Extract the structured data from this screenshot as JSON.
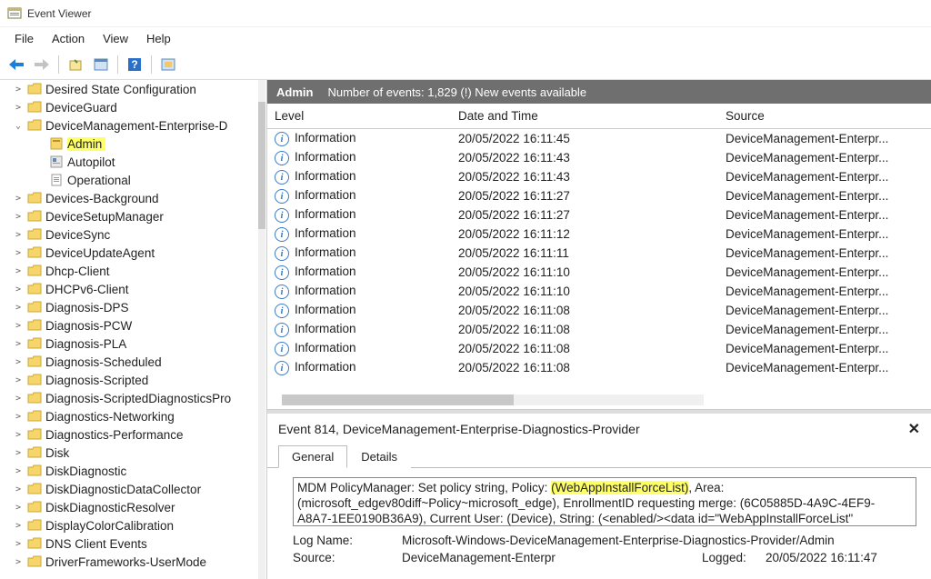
{
  "window": {
    "title": "Event Viewer"
  },
  "menu": {
    "file": "File",
    "action": "Action",
    "view": "View",
    "help": "Help"
  },
  "tree": {
    "items": [
      {
        "label": "Desired State Configuration",
        "lvl": 1,
        "exp": ">",
        "icon": "folder"
      },
      {
        "label": "DeviceGuard",
        "lvl": 1,
        "exp": ">",
        "icon": "folder"
      },
      {
        "label": "DeviceManagement-Enterprise-D",
        "lvl": 1,
        "exp": "v",
        "icon": "folder"
      },
      {
        "label": "Admin",
        "lvl": 2,
        "exp": "",
        "icon": "log",
        "hl": true
      },
      {
        "label": "Autopilot",
        "lvl": 2,
        "exp": "",
        "icon": "log"
      },
      {
        "label": "Operational",
        "lvl": 2,
        "exp": "",
        "icon": "log"
      },
      {
        "label": "Devices-Background",
        "lvl": 1,
        "exp": ">",
        "icon": "folder"
      },
      {
        "label": "DeviceSetupManager",
        "lvl": 1,
        "exp": ">",
        "icon": "folder"
      },
      {
        "label": "DeviceSync",
        "lvl": 1,
        "exp": ">",
        "icon": "folder"
      },
      {
        "label": "DeviceUpdateAgent",
        "lvl": 1,
        "exp": ">",
        "icon": "folder"
      },
      {
        "label": "Dhcp-Client",
        "lvl": 1,
        "exp": ">",
        "icon": "folder"
      },
      {
        "label": "DHCPv6-Client",
        "lvl": 1,
        "exp": ">",
        "icon": "folder"
      },
      {
        "label": "Diagnosis-DPS",
        "lvl": 1,
        "exp": ">",
        "icon": "folder"
      },
      {
        "label": "Diagnosis-PCW",
        "lvl": 1,
        "exp": ">",
        "icon": "folder"
      },
      {
        "label": "Diagnosis-PLA",
        "lvl": 1,
        "exp": ">",
        "icon": "folder"
      },
      {
        "label": "Diagnosis-Scheduled",
        "lvl": 1,
        "exp": ">",
        "icon": "folder"
      },
      {
        "label": "Diagnosis-Scripted",
        "lvl": 1,
        "exp": ">",
        "icon": "folder"
      },
      {
        "label": "Diagnosis-ScriptedDiagnosticsPro",
        "lvl": 1,
        "exp": ">",
        "icon": "folder"
      },
      {
        "label": "Diagnostics-Networking",
        "lvl": 1,
        "exp": ">",
        "icon": "folder"
      },
      {
        "label": "Diagnostics-Performance",
        "lvl": 1,
        "exp": ">",
        "icon": "folder"
      },
      {
        "label": "Disk",
        "lvl": 1,
        "exp": ">",
        "icon": "folder"
      },
      {
        "label": "DiskDiagnostic",
        "lvl": 1,
        "exp": ">",
        "icon": "folder"
      },
      {
        "label": "DiskDiagnosticDataCollector",
        "lvl": 1,
        "exp": ">",
        "icon": "folder"
      },
      {
        "label": "DiskDiagnosticResolver",
        "lvl": 1,
        "exp": ">",
        "icon": "folder"
      },
      {
        "label": "DisplayColorCalibration",
        "lvl": 1,
        "exp": ">",
        "icon": "folder"
      },
      {
        "label": "DNS Client Events",
        "lvl": 1,
        "exp": ">",
        "icon": "folder"
      },
      {
        "label": "DriverFrameworks-UserMode",
        "lvl": 1,
        "exp": ">",
        "icon": "folder"
      }
    ]
  },
  "panel": {
    "name": "Admin",
    "status": "Number of events: 1,829 (!) New events available"
  },
  "columns": {
    "level": "Level",
    "date": "Date and Time",
    "source": "Source"
  },
  "events": [
    {
      "level": "Information",
      "date": "20/05/2022 16:11:45",
      "source": "DeviceManagement-Enterpr..."
    },
    {
      "level": "Information",
      "date": "20/05/2022 16:11:43",
      "source": "DeviceManagement-Enterpr..."
    },
    {
      "level": "Information",
      "date": "20/05/2022 16:11:43",
      "source": "DeviceManagement-Enterpr..."
    },
    {
      "level": "Information",
      "date": "20/05/2022 16:11:27",
      "source": "DeviceManagement-Enterpr..."
    },
    {
      "level": "Information",
      "date": "20/05/2022 16:11:27",
      "source": "DeviceManagement-Enterpr..."
    },
    {
      "level": "Information",
      "date": "20/05/2022 16:11:12",
      "source": "DeviceManagement-Enterpr..."
    },
    {
      "level": "Information",
      "date": "20/05/2022 16:11:11",
      "source": "DeviceManagement-Enterpr..."
    },
    {
      "level": "Information",
      "date": "20/05/2022 16:11:10",
      "source": "DeviceManagement-Enterpr..."
    },
    {
      "level": "Information",
      "date": "20/05/2022 16:11:10",
      "source": "DeviceManagement-Enterpr..."
    },
    {
      "level": "Information",
      "date": "20/05/2022 16:11:08",
      "source": "DeviceManagement-Enterpr..."
    },
    {
      "level": "Information",
      "date": "20/05/2022 16:11:08",
      "source": "DeviceManagement-Enterpr..."
    },
    {
      "level": "Information",
      "date": "20/05/2022 16:11:08",
      "source": "DeviceManagement-Enterpr..."
    },
    {
      "level": "Information",
      "date": "20/05/2022 16:11:08",
      "source": "DeviceManagement-Enterpr..."
    }
  ],
  "detail": {
    "title": "Event 814, DeviceManagement-Enterprise-Diagnostics-Provider",
    "tabs": {
      "general": "General",
      "details": "Details"
    },
    "msg_pre": "MDM PolicyManager: Set policy string, Policy: ",
    "msg_hl": "(WebAppInstallForceList)",
    "msg_post1": ", Area: ",
    "msg_line2": "(microsoft_edgev80diff~Policy~microsoft_edge), EnrollmentID requesting merge: (6C05885D-4A9C-4EF9-",
    "msg_line3": "A8A7-1EE0190B36A9), Current User: (Device), String: (<enabled/><data id=\"WebAppInstallForceList\"",
    "lognamelbl": "Log Name:",
    "logname": "Microsoft-Windows-DeviceManagement-Enterprise-Diagnostics-Provider/Admin",
    "sourcelbl": "Source:",
    "source": "DeviceManagement-Enterpr",
    "loggedlbl": "Logged:",
    "logged": "20/05/2022 16:11:47"
  }
}
